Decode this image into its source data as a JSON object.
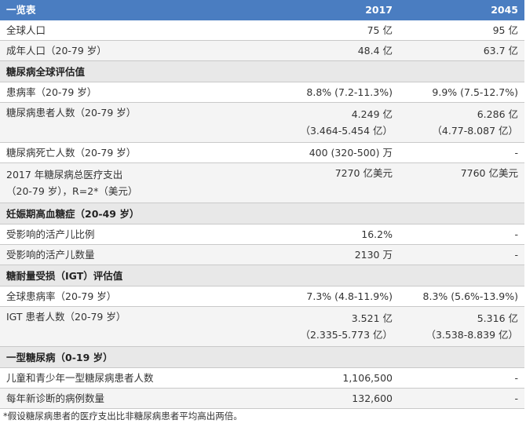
{
  "header": {
    "title": "一览表",
    "col_2017": "2017",
    "col_2045": "2045"
  },
  "rows": [
    {
      "type": "data",
      "label": "全球人口",
      "v2017": "75 亿",
      "v2045": "95 亿"
    },
    {
      "type": "data",
      "label": "成年人口（20-79 岁）",
      "v2017": "48.4 亿",
      "v2045": "63.7 亿"
    },
    {
      "type": "section",
      "label": "糖尿病全球评估值"
    },
    {
      "type": "data",
      "label": "患病率（20-79 岁）",
      "v2017": "8.8% (7.2-11.3%)",
      "v2045": "9.9% (7.5-12.7%)"
    },
    {
      "type": "data2",
      "label": "糖尿病患者人数（20-79 岁）",
      "v2017": "4.249 亿",
      "v2017b": "（3.464-5.454 亿）",
      "v2045": "6.286 亿",
      "v2045b": "（4.77-8.087 亿）"
    },
    {
      "type": "data",
      "label": "糖尿病死亡人数（20-79 岁）",
      "v2017": "400 (320-500) 万",
      "v2045": "-"
    },
    {
      "type": "data2",
      "label": "2017 年糖尿病总医疗支出",
      "labelb": "（20-79 岁），R=2*（美元）",
      "v2017": "7270 亿美元",
      "v2045": "7760 亿美元"
    },
    {
      "type": "section",
      "label": "妊娠期高血糖症（20-49 岁）"
    },
    {
      "type": "data",
      "label": "受影响的活产儿比例",
      "v2017": "16.2%",
      "v2045": "-"
    },
    {
      "type": "data",
      "label": "受影响的活产儿数量",
      "v2017": "2130 万",
      "v2045": "-"
    },
    {
      "type": "section",
      "label": "糖耐量受损（IGT）评估值"
    },
    {
      "type": "data",
      "label": "全球患病率（20-79 岁）",
      "v2017": "7.3% (4.8-11.9%)",
      "v2045": "8.3% (5.6%-13.9%)"
    },
    {
      "type": "data2",
      "label": "IGT 患者人数（20-79 岁）",
      "v2017": "3.521 亿",
      "v2017b": "（2.335-5.773 亿）",
      "v2045": "5.316 亿",
      "v2045b": "（3.538-8.839 亿）"
    },
    {
      "type": "section",
      "label": "一型糖尿病（0-19 岁）"
    },
    {
      "type": "data",
      "label": "儿童和青少年一型糖尿病患者人数",
      "v2017": "1,106,500",
      "v2045": "-"
    },
    {
      "type": "data",
      "label": "每年新诊断的病例数量",
      "v2017": "132,600",
      "v2045": "-"
    }
  ],
  "footnote": "*假设糖尿病患者的医疗支出比非糖尿病患者平均高出两倍。"
}
